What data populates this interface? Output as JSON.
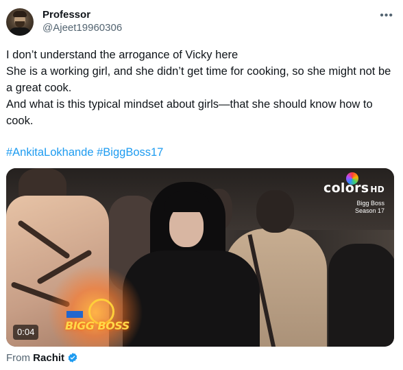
{
  "author": {
    "display_name": "Professor",
    "handle": "@Ajeet19960306"
  },
  "menu_icon": "ellipsis-icon",
  "tweet": {
    "lines": [
      "I don’t understand the arrogance of Vicky here",
      "She is a working girl, and she didn’t get time for cooking, so she might not be a great cook.",
      "And what is this typical mindset about girls—that she should know how to cook."
    ],
    "hashtags": [
      "#AnkitaLokhande",
      "#BiggBoss17"
    ]
  },
  "video": {
    "timestamp": "0:04",
    "channel": "colors",
    "channel_suffix": "HD",
    "show_line1": "Bigg Boss",
    "show_line2": "Season 17",
    "logo_word": "BIGG BOSS"
  },
  "attribution": {
    "prefix": "From",
    "name": "Rachit",
    "verified_icon": "verified-badge-icon"
  },
  "colors": {
    "accent": "#1d9bf0",
    "secondary_text": "#536471"
  }
}
